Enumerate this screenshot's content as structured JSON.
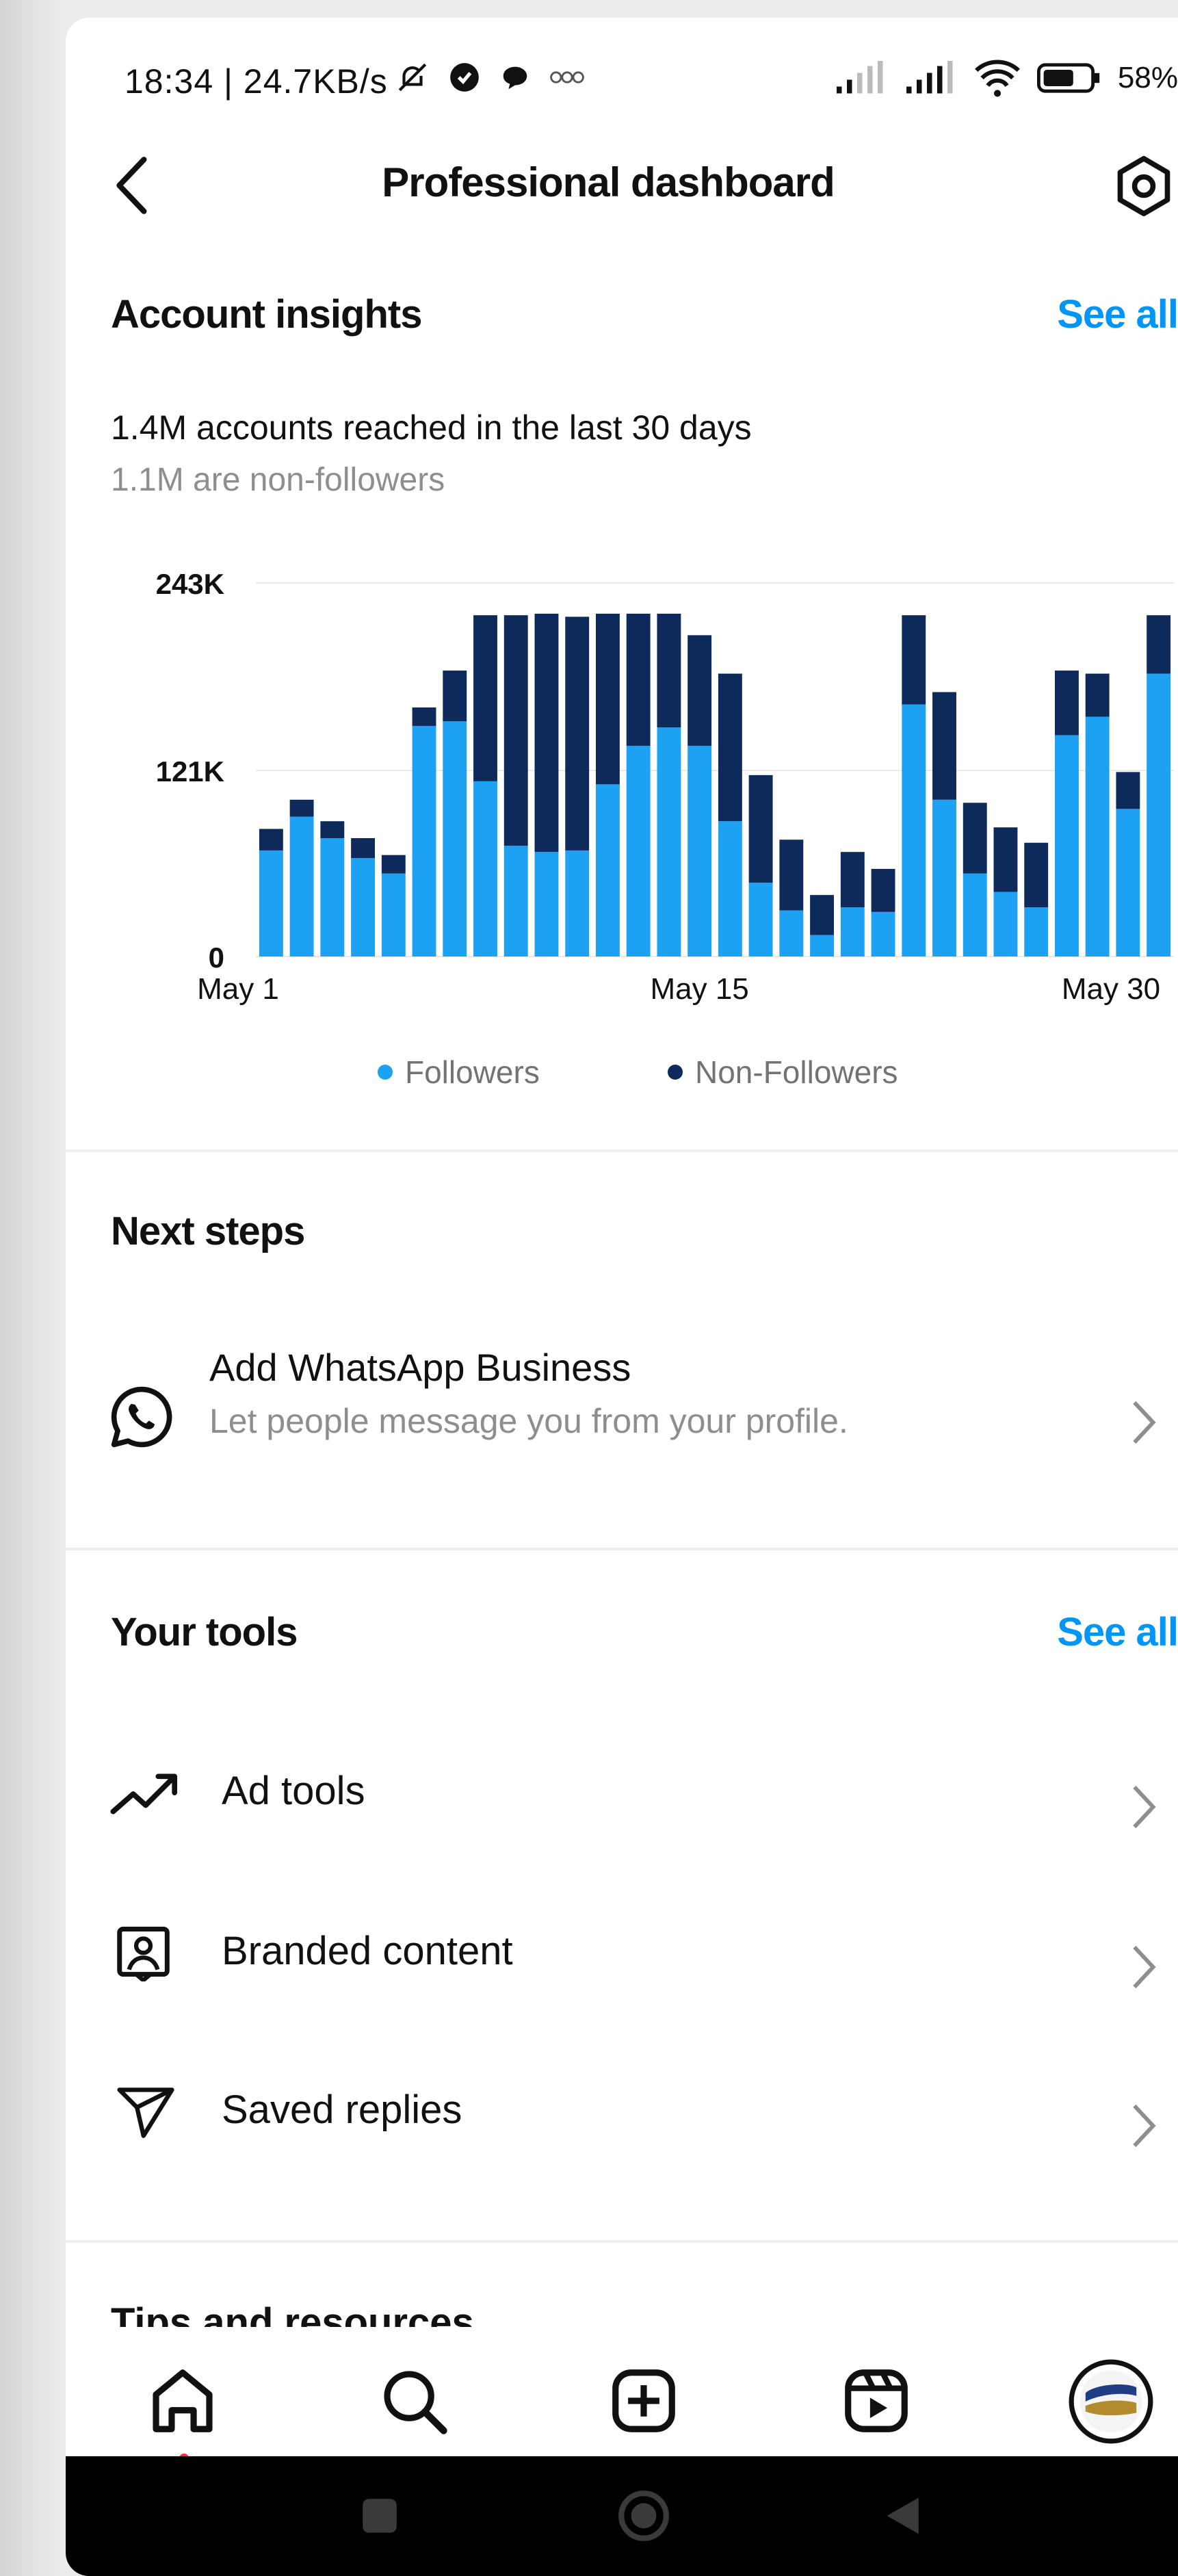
{
  "status_bar": {
    "time": "18:34 | 24.7KB/s",
    "battery": "58%",
    "icons": [
      "mute-bell-icon",
      "shield-icon",
      "chat-bubble-icon",
      "voice-icon",
      "signal-icon",
      "signal-icon",
      "wifi-icon",
      "battery-icon"
    ]
  },
  "header": {
    "title": "Professional dashboard",
    "back_icon": "chevron-left-icon",
    "settings_icon": "gear-icon"
  },
  "insights": {
    "title": "Account insights",
    "see_all": "See all",
    "reach_text": "1.4M accounts reached in the last 30 days",
    "nonfollowers_text": "1.1M are non-followers"
  },
  "chart_data": {
    "type": "bar",
    "stacked": true,
    "yticks": [
      "243K",
      "121K",
      "0"
    ],
    "ylim": [
      0,
      243000
    ],
    "xticks": [
      "May 1",
      "May 15",
      "May 30"
    ],
    "categories": [
      "May 1",
      "May 2",
      "May 3",
      "May 4",
      "May 5",
      "May 6",
      "May 7",
      "May 8",
      "May 9",
      "May 10",
      "May 11",
      "May 12",
      "May 13",
      "May 14",
      "May 15",
      "May 16",
      "May 17",
      "May 18",
      "May 19",
      "May 20",
      "May 21",
      "May 22",
      "May 23",
      "May 24",
      "May 25",
      "May 26",
      "May 27",
      "May 28",
      "May 29",
      "May 30"
    ],
    "series": [
      {
        "name": "Followers",
        "color": "#1da1f2",
        "values": [
          69000,
          91000,
          77000,
          64000,
          54000,
          150000,
          153000,
          114000,
          72000,
          68000,
          69000,
          112000,
          137000,
          149000,
          137000,
          88000,
          48000,
          30000,
          14000,
          32000,
          29000,
          164000,
          102000,
          54000,
          42000,
          32000,
          144000,
          156000,
          96000,
          184000
        ]
      },
      {
        "name": "Non-Followers",
        "color": "#0d2a5a",
        "values": [
          14000,
          11000,
          11000,
          13000,
          12000,
          12000,
          33000,
          108000,
          150000,
          155000,
          152000,
          111000,
          86000,
          74000,
          72000,
          96000,
          70000,
          46000,
          26000,
          36000,
          28000,
          58000,
          70000,
          46000,
          42000,
          42000,
          42000,
          28000,
          24000,
          38000
        ]
      }
    ],
    "grid": true,
    "legend_position": "bottom"
  },
  "legend": {
    "followers": "Followers",
    "non_followers": "Non-Followers"
  },
  "next_steps": {
    "title": "Next steps",
    "item_title": "Add WhatsApp Business",
    "item_subtitle": "Let people message you from your profile.",
    "item_icon": "whatsapp-icon"
  },
  "tools": {
    "title": "Your tools",
    "see_all": "See all",
    "items": [
      {
        "label": "Ad tools",
        "icon": "trending-up-icon"
      },
      {
        "label": "Branded content",
        "icon": "id-badge-icon"
      },
      {
        "label": "Saved replies",
        "icon": "paper-plane-icon"
      }
    ]
  },
  "tips": {
    "title": "Tips and resources"
  },
  "bottom_nav": [
    "home-icon",
    "search-icon",
    "add-icon",
    "reels-icon",
    "profile-avatar-icon"
  ],
  "system_nav": [
    "recents-square-icon",
    "home-circle-icon",
    "back-triangle-icon"
  ]
}
